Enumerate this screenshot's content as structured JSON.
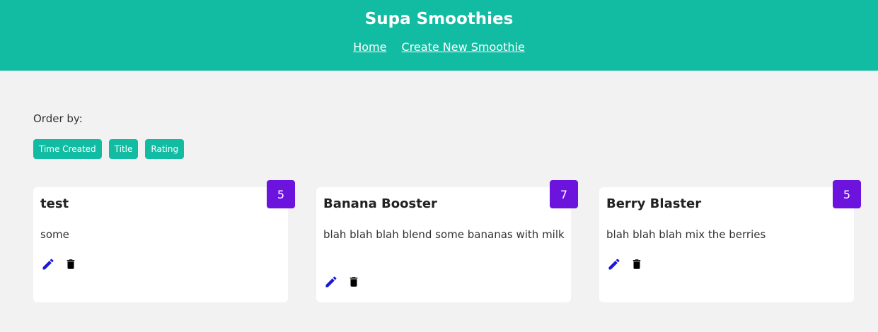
{
  "header": {
    "title": "Supa Smoothies",
    "nav": {
      "home": "Home",
      "create": "Create New Smoothie"
    }
  },
  "order": {
    "label": "Order by:",
    "buttons": [
      "Time Created",
      "Title",
      "Rating"
    ]
  },
  "smoothies": [
    {
      "title": "test",
      "method": "some",
      "rating": "5"
    },
    {
      "title": "Banana Booster",
      "method": "blah blah blah blend some bananas with milk",
      "rating": "7"
    },
    {
      "title": "Berry Blaster",
      "method": "blah blah blah mix the berries",
      "rating": "5"
    }
  ],
  "colors": {
    "brand": "#12bca2",
    "rating_badge": "#6c14dd",
    "edit_icon": "#1a1ad6",
    "delete_icon": "#000000",
    "background": "#f2f2f2"
  },
  "icons": {
    "edit": "pencil-icon",
    "delete": "trash-icon"
  }
}
